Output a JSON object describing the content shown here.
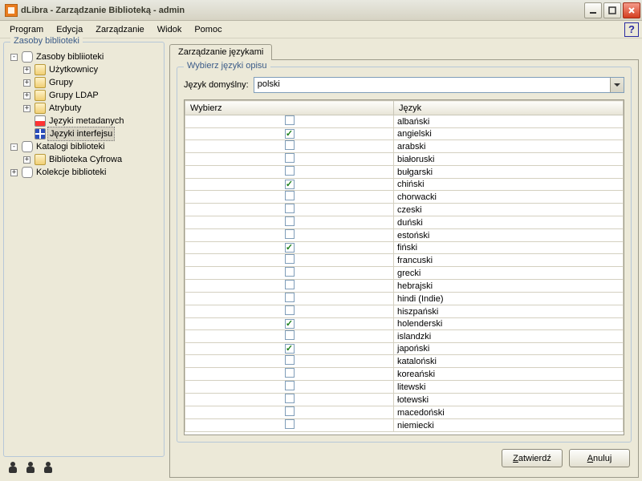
{
  "window": {
    "title": "dLibra - Zarządzanie Biblioteką - admin"
  },
  "menu": {
    "program": "Program",
    "edycja": "Edycja",
    "zarzadzanie": "Zarządzanie",
    "widok": "Widok",
    "pomoc": "Pomoc"
  },
  "sidebar": {
    "title": "Zasoby biblioteki",
    "root": "Zasoby bibliioteki",
    "uzytkownicy": "Użytkownicy",
    "grupy": "Grupy",
    "grupy_ldap": "Grupy LDAP",
    "atrybuty": "Atrybuty",
    "jezyki_metadanych": "Języki metadanych",
    "jezyki_interfejsu": "Języki interfejsu",
    "katalogi": "Katalogi biblioteki",
    "biblioteka_cyfrowa": "Biblioteka Cyfrowa",
    "kolekcje": "Kolekcje biblioteki"
  },
  "tab": {
    "label": "Zarządzanie językami"
  },
  "panel": {
    "group_title": "Wybierz języki opisu",
    "default_label": "Język domyślny:",
    "default_value": "polski",
    "col_select": "Wybierz",
    "col_lang": "Język"
  },
  "languages": [
    {
      "name": "albański",
      "checked": false
    },
    {
      "name": "angielski",
      "checked": true
    },
    {
      "name": "arabski",
      "checked": false
    },
    {
      "name": "białoruski",
      "checked": false
    },
    {
      "name": "bułgarski",
      "checked": false
    },
    {
      "name": "chiński",
      "checked": true
    },
    {
      "name": "chorwacki",
      "checked": false
    },
    {
      "name": "czeski",
      "checked": false
    },
    {
      "name": "duński",
      "checked": false
    },
    {
      "name": "estoński",
      "checked": false
    },
    {
      "name": "fiński",
      "checked": true
    },
    {
      "name": "francuski",
      "checked": false
    },
    {
      "name": "grecki",
      "checked": false
    },
    {
      "name": "hebrajski",
      "checked": false
    },
    {
      "name": "hindi (Indie)",
      "checked": false
    },
    {
      "name": "hiszpański",
      "checked": false
    },
    {
      "name": "holenderski",
      "checked": true
    },
    {
      "name": "islandzki",
      "checked": false
    },
    {
      "name": "japoński",
      "checked": true
    },
    {
      "name": "kataloński",
      "checked": false
    },
    {
      "name": "koreański",
      "checked": false
    },
    {
      "name": "litewski",
      "checked": false
    },
    {
      "name": "łotewski",
      "checked": false
    },
    {
      "name": "macedoński",
      "checked": false
    },
    {
      "name": "niemiecki",
      "checked": false
    }
  ],
  "buttons": {
    "ok": "Zatwierdź",
    "ok_ul": "Z",
    "cancel": "Anuluj",
    "cancel_ul": "A"
  }
}
